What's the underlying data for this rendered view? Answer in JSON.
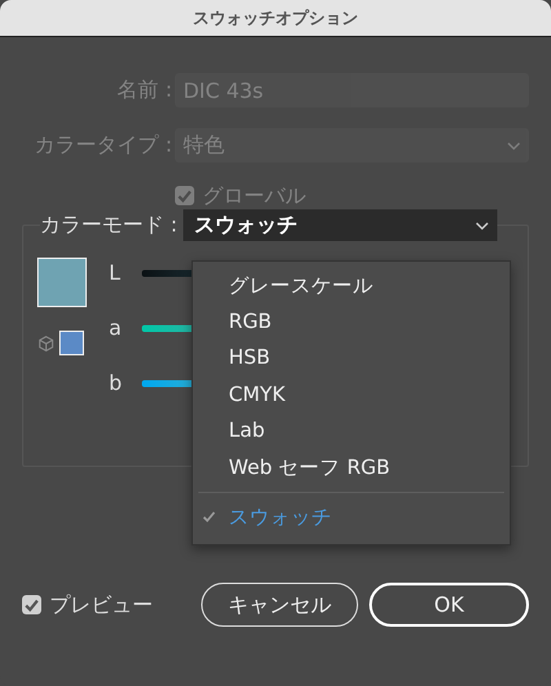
{
  "window": {
    "title": "スウォッチオプション"
  },
  "name_field": {
    "label": "名前 :",
    "value": "DIC 43s",
    "disabled": true
  },
  "color_type": {
    "label": "カラータイプ :",
    "value": "特色",
    "disabled": true
  },
  "global": {
    "label": "グローバル",
    "checked": true,
    "disabled": true
  },
  "color_mode": {
    "label": "カラーモード :",
    "value": "スウォッチ",
    "expanded": true,
    "option_groups": [
      [
        {
          "label": "グレースケール",
          "selected": false
        },
        {
          "label": "RGB",
          "selected": false
        },
        {
          "label": "HSB",
          "selected": false
        },
        {
          "label": "CMYK",
          "selected": false
        },
        {
          "label": "Lab",
          "selected": false
        },
        {
          "label": "Web セーフ RGB",
          "selected": false
        }
      ],
      [
        {
          "label": "スウォッチ",
          "selected": true
        }
      ]
    ]
  },
  "sliders": [
    {
      "label": "L",
      "kind": "lightness"
    },
    {
      "label": "a",
      "kind": "green-red"
    },
    {
      "label": "b",
      "kind": "blue-yellow"
    }
  ],
  "preview": {
    "label": "プレビュー",
    "checked": true
  },
  "buttons": [
    {
      "label": "キャンセル",
      "kind": "cancel"
    },
    {
      "label": "OK",
      "kind": "default"
    }
  ]
}
